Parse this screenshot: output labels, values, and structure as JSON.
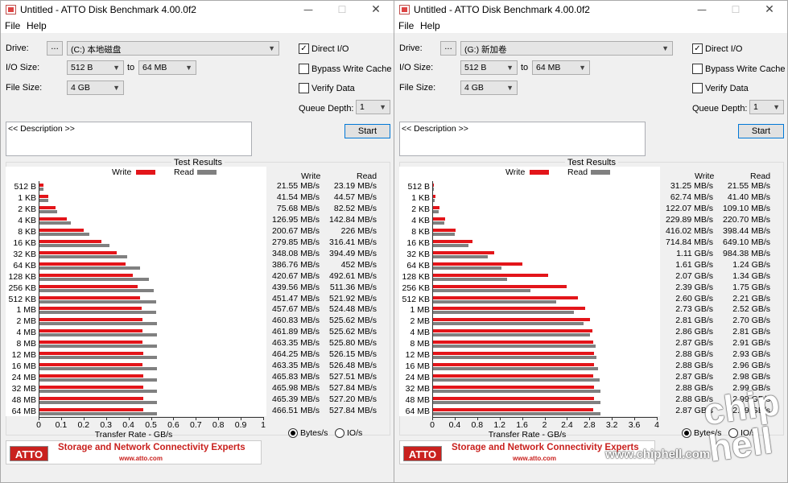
{
  "windows": [
    {
      "title": "Untitled - ATTO Disk Benchmark 4.00.0f2",
      "menu": {
        "file": "File",
        "help": "Help"
      },
      "drive_label": "Drive:",
      "drive_value": "(C:) 本地磁盘",
      "browse_label": "...",
      "io_size_label": "I/O Size:",
      "io_from": "512 B",
      "io_to_label": "to",
      "io_to": "64 MB",
      "file_size_label": "File Size:",
      "file_size": "4 GB",
      "direct_io": "Direct I/O",
      "bypass_cache": "Bypass Write Cache",
      "verify_data": "Verify Data",
      "queue_depth_label": "Queue Depth:",
      "queue_depth": "1",
      "description": "<< Description >>",
      "start": "Start",
      "results_title": "Test Results",
      "legend_write": "Write",
      "legend_read": "Read",
      "col_write": "Write",
      "col_read": "Read",
      "axis_title": "Transfer Rate - GB/s",
      "opt_bytes": "Bytes/s",
      "opt_io": "IO/s",
      "banner_logo": "ATTO",
      "banner_tag": "Storage and Network Connectivity Experts",
      "banner_url": "www.atto.com",
      "write_text": [
        "21.55 MB/s",
        "41.54 MB/s",
        "75.68 MB/s",
        "126.95 MB/s",
        "200.67 MB/s",
        "279.85 MB/s",
        "348.08 MB/s",
        "386.76 MB/s",
        "420.67 MB/s",
        "439.56 MB/s",
        "451.47 MB/s",
        "457.67 MB/s",
        "460.83 MB/s",
        "461.89 MB/s",
        "463.35 MB/s",
        "464.25 MB/s",
        "463.35 MB/s",
        "465.83 MB/s",
        "465.98 MB/s",
        "465.39 MB/s",
        "466.51 MB/s"
      ],
      "read_text": [
        "23.19 MB/s",
        "44.57 MB/s",
        "82.52 MB/s",
        "142.84 MB/s",
        "226 MB/s",
        "316.41 MB/s",
        "394.49 MB/s",
        "452 MB/s",
        "492.61 MB/s",
        "511.36 MB/s",
        "521.92 MB/s",
        "524.48 MB/s",
        "525.62 MB/s",
        "525.62 MB/s",
        "525.80 MB/s",
        "526.15 MB/s",
        "526.48 MB/s",
        "527.51 MB/s",
        "527.84 MB/s",
        "527.20 MB/s",
        "527.84 MB/s"
      ]
    },
    {
      "title": "Untitled - ATTO Disk Benchmark 4.00.0f2",
      "menu": {
        "file": "File",
        "help": "Help"
      },
      "drive_label": "Drive:",
      "drive_value": "(G:) 新加卷",
      "browse_label": "...",
      "io_size_label": "I/O Size:",
      "io_from": "512 B",
      "io_to_label": "to",
      "io_to": "64 MB",
      "file_size_label": "File Size:",
      "file_size": "4 GB",
      "direct_io": "Direct I/O",
      "bypass_cache": "Bypass Write Cache",
      "verify_data": "Verify Data",
      "queue_depth_label": "Queue Depth:",
      "queue_depth": "1",
      "description": "<< Description >>",
      "start": "Start",
      "results_title": "Test Results",
      "legend_write": "Write",
      "legend_read": "Read",
      "col_write": "Write",
      "col_read": "Read",
      "axis_title": "Transfer Rate - GB/s",
      "opt_bytes": "Bytes/s",
      "opt_io": "IO/s",
      "banner_logo": "ATTO",
      "banner_tag": "Storage and Network Connectivity Experts",
      "banner_url": "www.atto.com",
      "write_text": [
        "31.25 MB/s",
        "62.74 MB/s",
        "122.07 MB/s",
        "229.89 MB/s",
        "416.02 MB/s",
        "714.84 MB/s",
        "1.11 GB/s",
        "1.61 GB/s",
        "2.07 GB/s",
        "2.39 GB/s",
        "2.60 GB/s",
        "2.73 GB/s",
        "2.81 GB/s",
        "2.86 GB/s",
        "2.87 GB/s",
        "2.88 GB/s",
        "2.88 GB/s",
        "2.87 GB/s",
        "2.88 GB/s",
        "2.88 GB/s",
        "2.87 GB/s"
      ],
      "read_text": [
        "21.55 MB/s",
        "41.40 MB/s",
        "109.10 MB/s",
        "220.70 MB/s",
        "398.44 MB/s",
        "649.10 MB/s",
        "984.38 MB/s",
        "1.24 GB/s",
        "1.34 GB/s",
        "1.75 GB/s",
        "2.21 GB/s",
        "2.52 GB/s",
        "2.70 GB/s",
        "2.81 GB/s",
        "2.91 GB/s",
        "2.93 GB/s",
        "2.96 GB/s",
        "2.98 GB/s",
        "2.99 GB/s",
        "2.99 GB/s",
        "2.99 GB/s"
      ]
    }
  ],
  "chart_data": [
    {
      "type": "bar",
      "title": "Test Results",
      "xlabel": "Transfer Rate - GB/s",
      "xlim": [
        0,
        1
      ],
      "xticks": [
        "0",
        "0.1",
        "0.2",
        "0.3",
        "0.4",
        "0.5",
        "0.6",
        "0.7",
        "0.8",
        "0.9",
        "1"
      ],
      "categories": [
        "512 B",
        "1 KB",
        "2 KB",
        "4 KB",
        "8 KB",
        "16 KB",
        "32 KB",
        "64 KB",
        "128 KB",
        "256 KB",
        "512 KB",
        "1 MB",
        "2 MB",
        "4 MB",
        "8 MB",
        "12 MB",
        "16 MB",
        "24 MB",
        "32 MB",
        "48 MB",
        "64 MB"
      ],
      "series": [
        {
          "name": "Write",
          "color": "#e3151a",
          "values": [
            0.02155,
            0.04154,
            0.07568,
            0.12695,
            0.20067,
            0.27985,
            0.34808,
            0.38676,
            0.42067,
            0.43956,
            0.45147,
            0.45767,
            0.46083,
            0.46189,
            0.46335,
            0.46425,
            0.46335,
            0.46583,
            0.46598,
            0.46539,
            0.46651
          ]
        },
        {
          "name": "Read",
          "color": "#808080",
          "values": [
            0.02319,
            0.04457,
            0.08252,
            0.14284,
            0.226,
            0.31641,
            0.39449,
            0.452,
            0.49261,
            0.51136,
            0.52192,
            0.52448,
            0.52562,
            0.52562,
            0.5258,
            0.52615,
            0.52648,
            0.52751,
            0.52784,
            0.5272,
            0.52784
          ]
        }
      ]
    },
    {
      "type": "bar",
      "title": "Test Results",
      "xlabel": "Transfer Rate - GB/s",
      "xlim": [
        0,
        4
      ],
      "xticks": [
        "0",
        "0.4",
        "0.8",
        "1.2",
        "1.6",
        "2",
        "2.4",
        "2.8",
        "3.2",
        "3.6",
        "4"
      ],
      "categories": [
        "512 B",
        "1 KB",
        "2 KB",
        "4 KB",
        "8 KB",
        "16 KB",
        "32 KB",
        "64 KB",
        "128 KB",
        "256 KB",
        "512 KB",
        "1 MB",
        "2 MB",
        "4 MB",
        "8 MB",
        "12 MB",
        "16 MB",
        "24 MB",
        "32 MB",
        "48 MB",
        "64 MB"
      ],
      "series": [
        {
          "name": "Write",
          "color": "#e3151a",
          "values": [
            0.03125,
            0.06274,
            0.12207,
            0.22989,
            0.41602,
            0.71484,
            1.11,
            1.61,
            2.07,
            2.39,
            2.6,
            2.73,
            2.81,
            2.86,
            2.87,
            2.88,
            2.88,
            2.87,
            2.88,
            2.88,
            2.87
          ]
        },
        {
          "name": "Read",
          "color": "#808080",
          "values": [
            0.02155,
            0.0414,
            0.1091,
            0.2207,
            0.39844,
            0.6491,
            0.98438,
            1.24,
            1.34,
            1.75,
            2.21,
            2.52,
            2.7,
            2.81,
            2.91,
            2.93,
            2.96,
            2.98,
            2.99,
            2.99,
            2.99
          ]
        }
      ]
    }
  ],
  "watermark": {
    "url": "www.chiphell.com",
    "logo": "chip hell"
  }
}
